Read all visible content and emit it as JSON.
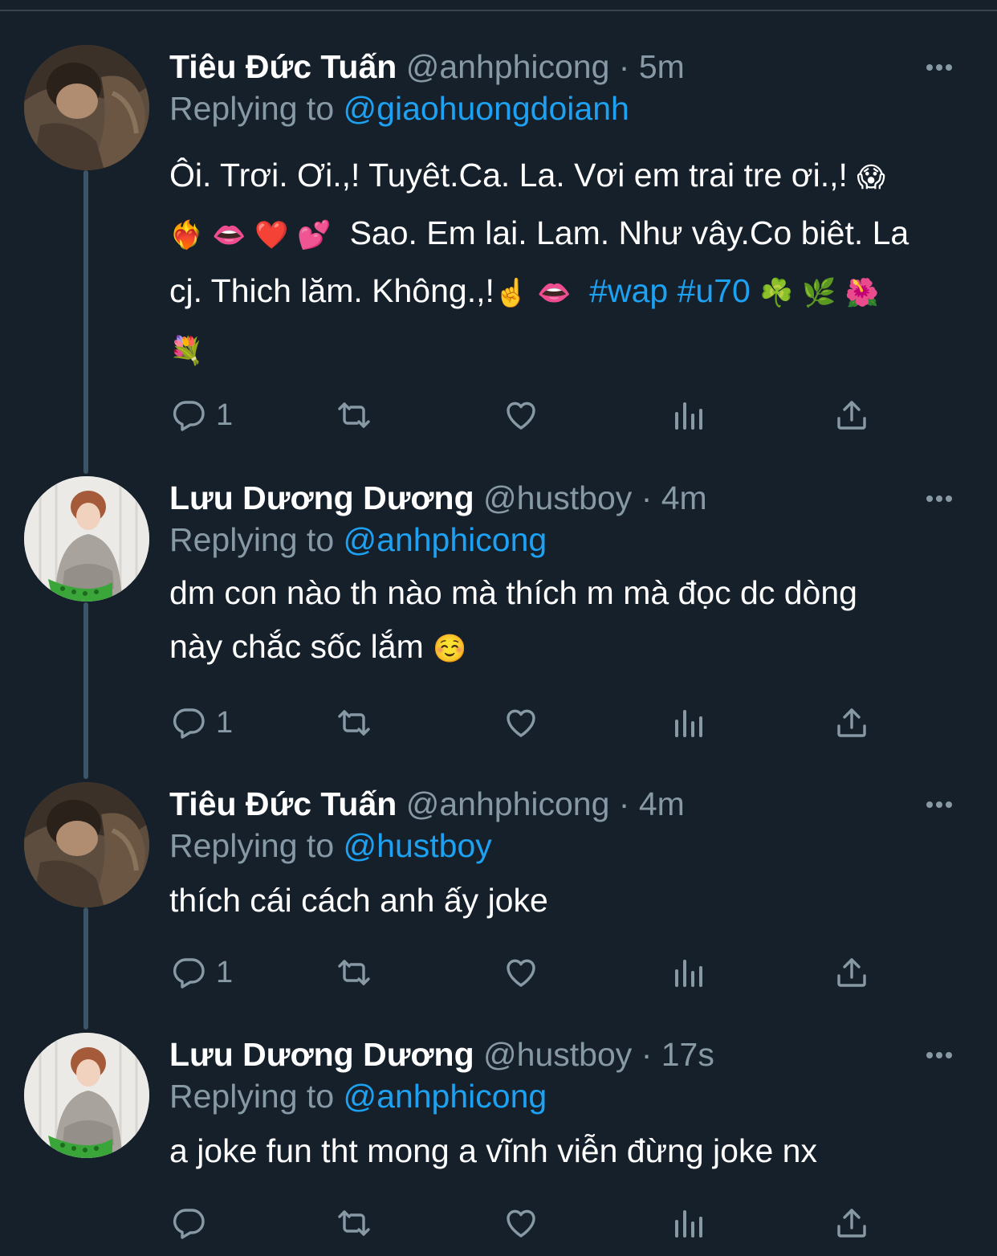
{
  "tweets": [
    {
      "name": "Tiêu Đức Tuấn",
      "handle": "@anhphicong",
      "dot": "·",
      "time": "5m",
      "replying_prefix": "Replying to",
      "replying_to": "@giaohuongdoianh",
      "text_line1": "Ôi. Trơi. Ơi.,! Tuyêt.Ca. La. Vơi em trai tre ơi.,!",
      "emoji_line1": "😱",
      "emoji_line2": "❤️‍🔥 👄 ❤️ 💕",
      "text_line2": "Sao. Em lai. Lam. Như vây.Co biêt. La",
      "text_line3": "cj. Thich lăm. Không.,!",
      "emoji_line3a": "☝️ 👄",
      "hashtags": "#wap #u70",
      "emoji_line3b": "☘️ 🌿 🌺",
      "emoji_line4": "💐",
      "reply_count": "1"
    },
    {
      "name": "Lưu Dương Dương",
      "handle": "@hustboy",
      "dot": "·",
      "time": "4m",
      "replying_prefix": "Replying to",
      "replying_to": "@anhphicong",
      "text_line1": "dm con nào th nào mà thích m mà đọc dc dòng",
      "text_line2": "này chắc sốc lắm",
      "emoji": "☺️",
      "reply_count": "1"
    },
    {
      "name": "Tiêu Đức Tuấn",
      "handle": "@anhphicong",
      "dot": "·",
      "time": "4m",
      "replying_prefix": "Replying to",
      "replying_to": "@hustboy",
      "text_line1": "thích cái cách anh ấy joke",
      "reply_count": "1"
    },
    {
      "name": "Lưu Dương Dương",
      "handle": "@hustboy",
      "dot": "·",
      "time": "17s",
      "replying_prefix": "Replying to",
      "replying_to": "@anhphicong",
      "text_line1": "a joke fun tht mong a vĩnh viễn đừng joke nx",
      "reply_count": ""
    }
  ],
  "icons": [
    "more-icon",
    "reply-icon",
    "retweet-icon",
    "like-icon",
    "analytics-icon",
    "share-icon"
  ],
  "colors": {
    "background": "#15202b",
    "link": "#1da1f2",
    "muted": "#8899a6",
    "text": "#ffffff"
  }
}
